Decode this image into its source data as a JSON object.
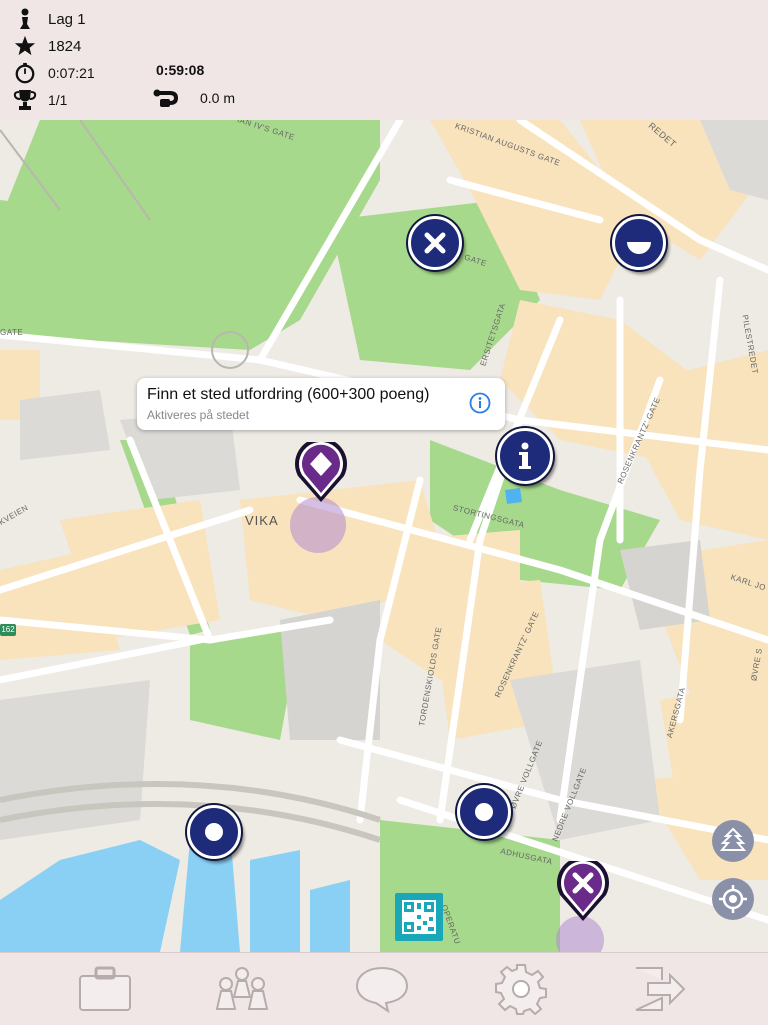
{
  "hud": {
    "team": "Lag 1",
    "score": "1824",
    "elapsed": "0:07:21",
    "remaining": "0:59:08",
    "progress": "1/1",
    "distance": "0.0 m",
    "icons": [
      "person-icon",
      "star-icon",
      "stopwatch-icon",
      "trophy-icon",
      "route-icon"
    ]
  },
  "map": {
    "area_label": "VIKA",
    "road_badge": "162",
    "streets": [
      "KRISTIAN AUGUSTS GATE",
      "IAN IV'S GATE",
      "GATE",
      "ERSITETSGATA",
      "STORTINGSGATA",
      "ROSENKRANTZ' GATE",
      "PILESTREDET",
      "KARL JO",
      "ØVRE S",
      "AKERSGATA",
      "TORDENSKIOLDS GATE",
      "ROSENKRANTZ' GATE",
      "ØVRE VOLLGATE",
      "NEDRE VOLLGATE",
      "ADHUSGATA",
      "OPERATU",
      "KKVEIEN",
      "REDET",
      "GATE"
    ],
    "colors": {
      "park": "#a6d98b",
      "block": "#f8e3bc",
      "water": "#8ad0f5",
      "road": "#ffffff",
      "marker": "#1e2a7a",
      "pin": "#6a2a8a"
    }
  },
  "popup": {
    "title": "Finn et sted utfordring (600+300 poeng)",
    "subtitle": "Aktiveres på stedet",
    "info_icon": "info-circle-icon"
  },
  "markers": [
    {
      "name": "cross-challenge-icon"
    },
    {
      "name": "half-moon-challenge-icon"
    },
    {
      "name": "info-challenge-icon"
    },
    {
      "name": "dot-challenge-icon"
    },
    {
      "name": "dot-challenge-icon"
    },
    {
      "name": "diamond-location-pin"
    },
    {
      "name": "cross-location-pin"
    }
  ],
  "controls": [
    "map-layers-icon",
    "locate-me-icon",
    "qr-code-icon"
  ],
  "tabs": [
    "briefcase-icon",
    "team-icon",
    "chat-icon",
    "settings-icon",
    "logout-icon"
  ]
}
